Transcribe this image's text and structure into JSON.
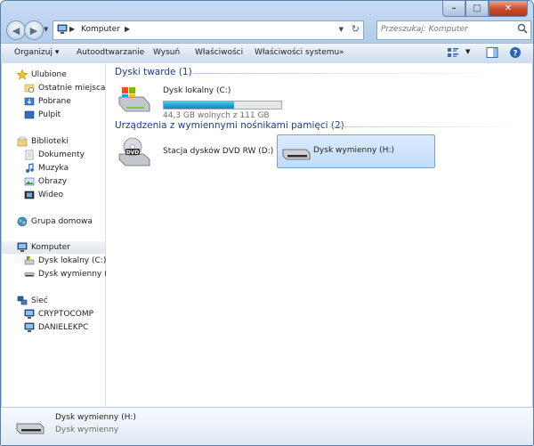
{
  "window": {
    "controls": {
      "minimize": "–",
      "maximize": "□",
      "close": "✕"
    }
  },
  "address": {
    "location": "Komputer",
    "search_placeholder": "Przeszukaj: Komputer"
  },
  "toolbar": {
    "organize": "Organizuj",
    "autoplay": "Autoodtwarzanie",
    "eject": "Wysuń",
    "properties": "Właściwości",
    "system_properties": "Właściwości systemu",
    "more": "»"
  },
  "nav": {
    "favorites": {
      "label": "Ulubione",
      "items": [
        "Ostatnie miejsca",
        "Pobrane",
        "Pulpit"
      ]
    },
    "libraries": {
      "label": "Biblioteki",
      "items": [
        "Dokumenty",
        "Muzyka",
        "Obrazy",
        "Wideo"
      ]
    },
    "homegroup": "Grupa domowa",
    "computer": {
      "label": "Komputer",
      "items": [
        "Dysk lokalny (C:)",
        "Dysk wymienny (H:)"
      ]
    },
    "network": {
      "label": "Sieć",
      "items": [
        "CRYPTOCOMP",
        "DANIELEKPC"
      ]
    }
  },
  "content": {
    "hdd_header": "Dyski twarde (1)",
    "removable_header": "Urządzenia z wymiennymi nośnikami pamięci (2)",
    "local_disk": {
      "name": "Dysk lokalny (C:)",
      "free": "44,3 GB wolnych z 111 GB",
      "used_fraction": 0.6
    },
    "dvd": {
      "name": "Stacja dysków DVD RW (D:)",
      "label": "DVD"
    },
    "removable": {
      "name": "Dysk wymienny (H:)"
    }
  },
  "details": {
    "name": "Dysk wymienny (H:)",
    "type": "Dysk wymienny"
  },
  "colors": {
    "accent": "#1e3a8a",
    "bar_fill": "#1d9fd6",
    "selection": "#c1dcfa"
  }
}
